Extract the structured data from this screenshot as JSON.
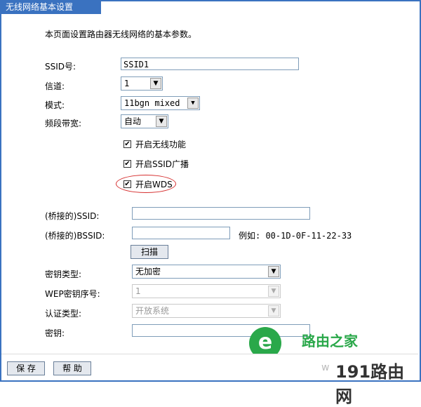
{
  "window": {
    "title": "无线网络基本设置"
  },
  "intro": "本页面设置路由器无线网络的基本参数。",
  "fields": {
    "ssid_label": "SSID号:",
    "ssid_value": "SSID1",
    "channel_label": "信道:",
    "channel_value": "1",
    "mode_label": "模式:",
    "mode_value": "11bgn mixed",
    "bandwidth_label": "频段带宽:",
    "bandwidth_value": "自动"
  },
  "checkboxes": {
    "wireless_label": "开启无线功能",
    "wireless_checked": "✔",
    "ssid_broadcast_label": "开启SSID广播",
    "ssid_broadcast_checked": "✔",
    "wds_label": "开启WDS",
    "wds_checked": "✔"
  },
  "wds": {
    "bridge_ssid_label": "(桥接的)SSID:",
    "bridge_ssid_value": "",
    "bridge_bssid_label": "(桥接的)BSSID:",
    "bridge_bssid_value": "",
    "bssid_example": "例如: 00-1D-0F-11-22-33",
    "scan_button": "扫描",
    "key_type_label": "密钥类型:",
    "key_type_value": "无加密",
    "wep_index_label": "WEP密钥序号:",
    "wep_index_value": "1",
    "auth_type_label": "认证类型:",
    "auth_type_value": "开放系统",
    "key_label": "密钥:",
    "key_value": ""
  },
  "buttons": {
    "save": "保 存",
    "help": "帮 助"
  },
  "watermark": {
    "text1": "路由之家",
    "text2": "191路由网",
    "text_dim": "w",
    "logo_glyph": "e"
  },
  "colors": {
    "title_bar": "#3a72c0",
    "highlight": "#d63030",
    "watermark": "#2aa84a"
  }
}
